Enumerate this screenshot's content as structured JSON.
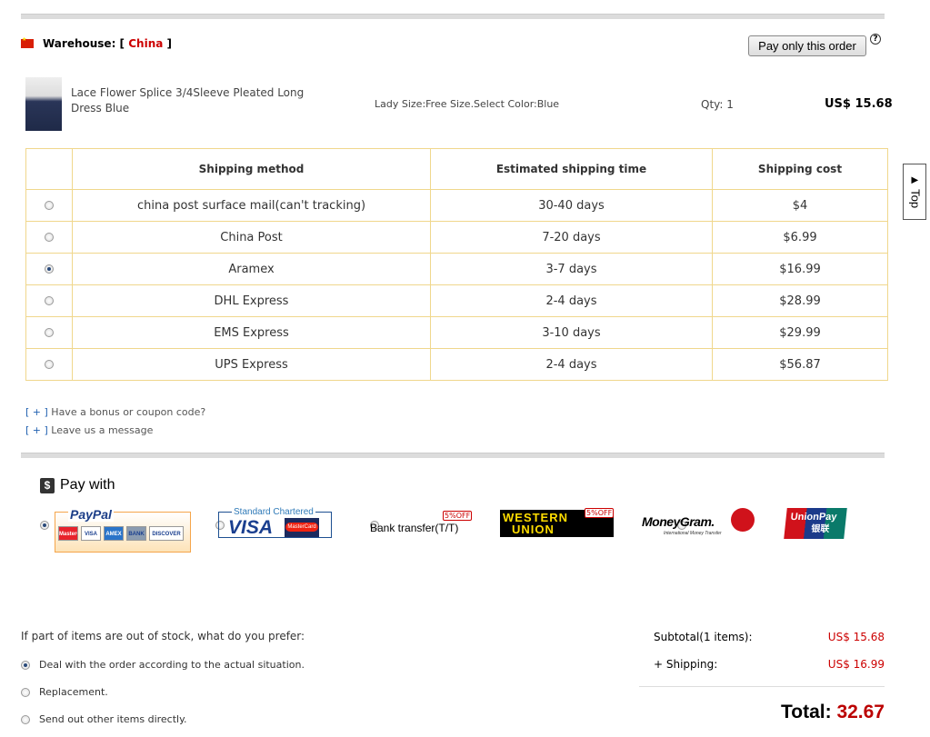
{
  "warehouse": {
    "label": "Warehouse: [",
    "country": "China",
    "close": "]",
    "pay_only_label": "Pay only this order",
    "help": "?"
  },
  "product": {
    "name": "Lace Flower Splice 3/4Sleeve Pleated Long Dress Blue",
    "attributes": "Lady Size:Free Size.Select Color:Blue",
    "qty": "Qty: 1",
    "price": "US$ 15.68"
  },
  "shipping": {
    "headers": [
      "Shipping method",
      "Estimated shipping time",
      "Shipping cost"
    ],
    "rows": [
      {
        "method": "china post surface mail(can't tracking)",
        "time": "30-40 days",
        "cost": "$4",
        "selected": false
      },
      {
        "method": "China Post",
        "time": "7-20 days",
        "cost": "$6.99",
        "selected": false
      },
      {
        "method": "Aramex",
        "time": "3-7 days",
        "cost": "$16.99",
        "selected": true
      },
      {
        "method": "DHL Express",
        "time": "2-4 days",
        "cost": "$28.99",
        "selected": false
      },
      {
        "method": "EMS Express",
        "time": "3-10 days",
        "cost": "$29.99",
        "selected": false
      },
      {
        "method": "UPS Express",
        "time": "2-4 days",
        "cost": "$56.87",
        "selected": false
      }
    ]
  },
  "links": {
    "plus": "[ + ]",
    "coupon": "Have a bonus or coupon code?",
    "message": "Leave us a message"
  },
  "payment": {
    "title": "Pay with",
    "dollar": "$",
    "paypal": "PayPal",
    "paypal_cards": [
      "MasterCard",
      "VISA",
      "AMEX",
      "BANK",
      "DISCOVER"
    ],
    "sc": "Standard Chartered",
    "visa": "VISA",
    "mastercard": "MasterCard",
    "bank": "Bank transfer(T/T)",
    "off": "5%OFF",
    "wu1": "WESTERN",
    "wu2": "UNION",
    "moneygram": "MoneyGram.",
    "moneygram_sub": "International Money Transfer",
    "unionpay": "UnionPay",
    "unionpay_cn": "银联"
  },
  "stock": {
    "question": "If part of items are out of stock, what do you prefer:",
    "options": [
      "Deal with the order according to the actual situation.",
      "Replacement.",
      "Send out other items directly."
    ]
  },
  "summary": {
    "subtotal_label": "Subtotal(1 items):",
    "subtotal": "US$ 15.68",
    "shipping_label": "+ Shipping:",
    "shipping": "US$ 16.99",
    "total_label": "Total:",
    "total": "32.67"
  },
  "top_tab": "Top"
}
